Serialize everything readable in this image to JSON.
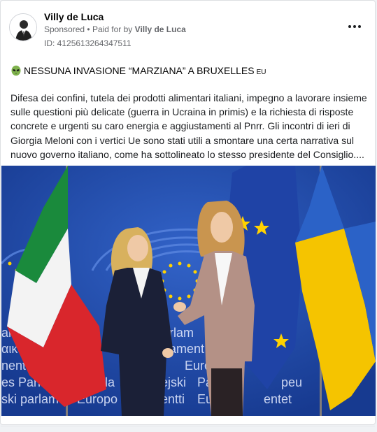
{
  "post": {
    "page_name": "Villy de Luca",
    "sponsored_label": "Sponsored",
    "separator": "•",
    "paid_for_prefix": "Paid for by",
    "paid_for_name": "Villy de Luca",
    "ad_id": "ID: 4125613264347511",
    "headline": "NESSUNA INVASIONE “MARZIANA” A BRUXELLES",
    "headline_flag": "EU",
    "body": "Difesa dei confini, tutela dei prodotti alimentari italiani, impegno a lavorare insieme sulle questioni più delicate (guerra in Ucraina in primis) e la richiesta di risposte concrete e urgenti su caro energia e aggiustamenti al Pnrr. Gli incontri di ieri di Giorgia Meloni con i vertici Ue sono stati utili a smontare una certa narrativa sul nuovo governo italiano, come ha sottolineato lo stesso presidente del Consiglio...."
  },
  "photo": {
    "backdrop_words": [
      "arlar",
      "αικό",
      "nento",
      "es Parle",
      "ski parlame",
      "arlam",
      "ament",
      "Europ",
      "pejski",
      "Parlan",
      "Europo",
      "nentti",
      "Europa",
      "entet",
      "peu",
      "Parla"
    ]
  },
  "icons": {
    "headline_emoji": "alien-icon",
    "menu": "more-options-icon"
  },
  "colors": {
    "eu_blue": "#1f47a8",
    "eu_star": "#ffd200",
    "italy_green": "#1a8a3c",
    "italy_red": "#d9262c",
    "ukraine_yellow": "#f5c400",
    "ukraine_blue": "#2b62c7",
    "meta_text": "#65676b"
  }
}
